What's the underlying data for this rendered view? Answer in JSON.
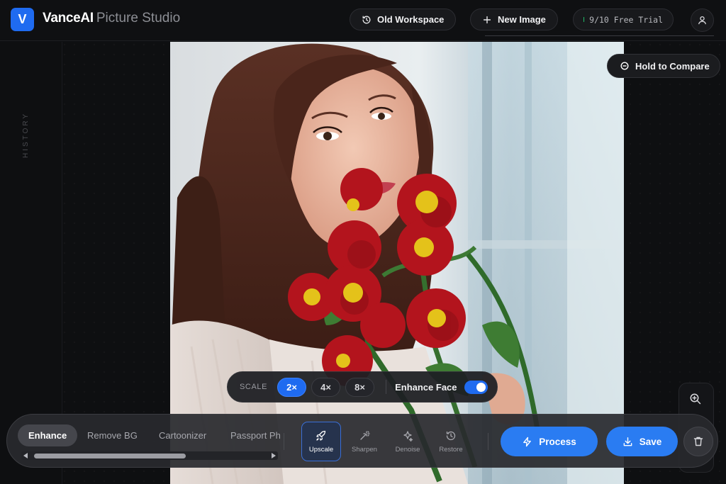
{
  "app": {
    "logo_letter": "V",
    "brand_name": "VanceAI",
    "brand_product": "Picture Studio",
    "accent_color": "#1f6bf0"
  },
  "header": {
    "old_workspace_label": "Old Workspace",
    "new_image_label": "New Image",
    "trial_label": "9/10 Free Trial",
    "trial_status_color": "#1fbf6a"
  },
  "history": {
    "label": "HISTORY"
  },
  "canvas": {
    "compare_label": "Hold to Compare",
    "image_subject": "woman holding red flowers photo"
  },
  "scale": {
    "label": "SCALE",
    "options": [
      "2×",
      "4×",
      "8×"
    ],
    "selected": "2×",
    "enhance_face_label": "Enhance Face",
    "enhance_face_on": true
  },
  "toolbar": {
    "tabs": [
      "Enhance",
      "Remove BG",
      "Cartoonizer",
      "Passport Photo"
    ],
    "active_tab": "Enhance",
    "tools": [
      {
        "label": "Upscale",
        "icon": "rocket-icon",
        "active": true
      },
      {
        "label": "Sharpen",
        "icon": "magic-wand-icon",
        "active": false
      },
      {
        "label": "Denoise",
        "icon": "sparkle-icon",
        "active": false
      },
      {
        "label": "Restore",
        "icon": "history-icon",
        "active": false
      }
    ],
    "process_label": "Process",
    "save_label": "Save"
  }
}
